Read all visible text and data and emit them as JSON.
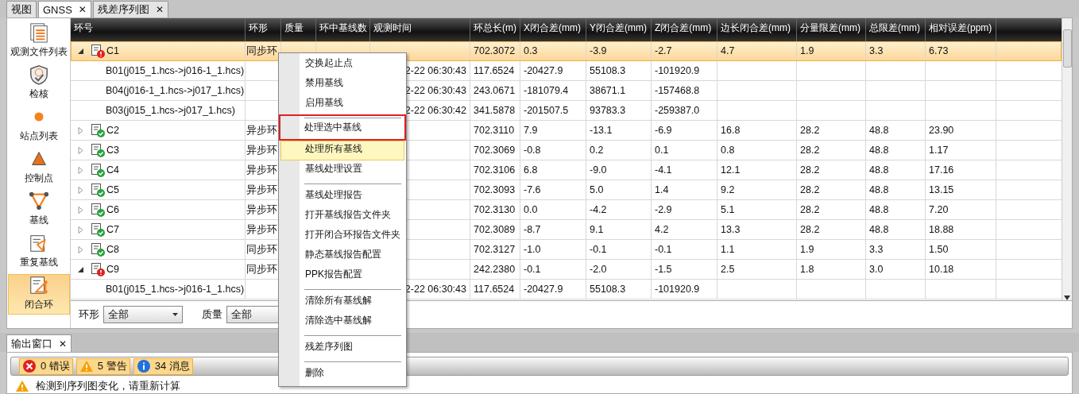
{
  "doc_tabs": [
    {
      "label": "视图",
      "selected": false
    },
    {
      "label": "GNSS",
      "selected": true,
      "close": "✕"
    },
    {
      "label": "残差序列图",
      "selected": false,
      "close": "✕"
    }
  ],
  "sidebar": {
    "items": [
      {
        "label": "观测文件列表",
        "selected": false
      },
      {
        "label": "检核",
        "selected": false
      },
      {
        "label": "站点列表",
        "selected": false
      },
      {
        "label": "控制点",
        "selected": false
      },
      {
        "label": "基线",
        "selected": false
      },
      {
        "label": "重复基线",
        "selected": false
      },
      {
        "label": "闭合环",
        "selected": true
      }
    ]
  },
  "table": {
    "columns": [
      "环号",
      "环形",
      "质量",
      "环中基线数",
      "观测时间",
      "环总长(m)",
      "X闭合差(mm)",
      "Y闭合差(mm)",
      "Z闭合差(mm)",
      "边长闭合差(mm)",
      "分量限差(mm)",
      "总限差(mm)",
      "相对误差(ppm)"
    ],
    "rows": [
      {
        "kind": "ring",
        "expanded": true,
        "error": true,
        "selected": true,
        "cells": [
          "C1",
          "同步环",
          "",
          "",
          "",
          "702.3072",
          "0.3",
          "-3.9",
          "-2.7",
          "4.7",
          "1.9",
          "3.3",
          "6.73"
        ]
      },
      {
        "kind": "baseline",
        "selected": false,
        "cells": [
          "B01(j015_1.hcs->j016-1_1.hcs)",
          "",
          "",
          "",
          "2-22 06:30:43",
          "117.6524",
          "-20427.9",
          "55108.3",
          "-101920.9",
          "",
          "",
          "",
          ""
        ]
      },
      {
        "kind": "baseline",
        "selected": false,
        "cells": [
          "B04(j016-1_1.hcs->j017_1.hcs)",
          "",
          "",
          "",
          "2-22 06:30:43",
          "243.0671",
          "-181079.4",
          "38671.1",
          "-157468.8",
          "",
          "",
          "",
          ""
        ]
      },
      {
        "kind": "baseline",
        "selected": false,
        "cells": [
          "B03(j015_1.hcs->j017_1.hcs)",
          "",
          "",
          "",
          "2-22 06:30:42",
          "341.5878",
          "-201507.5",
          "93783.3",
          "-259387.0",
          "",
          "",
          "",
          ""
        ]
      },
      {
        "kind": "ring",
        "expanded": false,
        "error": false,
        "selected": false,
        "cells": [
          "C2",
          "异步环",
          "",
          "",
          "",
          "702.3110",
          "7.9",
          "-13.1",
          "-6.9",
          "16.8",
          "28.2",
          "48.8",
          "23.90"
        ]
      },
      {
        "kind": "ring",
        "expanded": false,
        "error": false,
        "selected": false,
        "cells": [
          "C3",
          "异步环",
          "",
          "",
          "",
          "702.3069",
          "-0.8",
          "0.2",
          "0.1",
          "0.8",
          "28.2",
          "48.8",
          "1.17"
        ]
      },
      {
        "kind": "ring",
        "expanded": false,
        "error": false,
        "selected": false,
        "cells": [
          "C4",
          "异步环",
          "",
          "",
          "",
          "702.3106",
          "6.8",
          "-9.0",
          "-4.1",
          "12.1",
          "28.2",
          "48.8",
          "17.16"
        ]
      },
      {
        "kind": "ring",
        "expanded": false,
        "error": false,
        "selected": false,
        "cells": [
          "C5",
          "异步环",
          "",
          "",
          "",
          "702.3093",
          "-7.6",
          "5.0",
          "1.4",
          "9.2",
          "28.2",
          "48.8",
          "13.15"
        ]
      },
      {
        "kind": "ring",
        "expanded": false,
        "error": false,
        "selected": false,
        "cells": [
          "C6",
          "异步环",
          "",
          "",
          "",
          "702.3130",
          "0.0",
          "-4.2",
          "-2.9",
          "5.1",
          "28.2",
          "48.8",
          "7.20"
        ]
      },
      {
        "kind": "ring",
        "expanded": false,
        "error": false,
        "selected": false,
        "cells": [
          "C7",
          "异步环",
          "",
          "",
          "",
          "702.3089",
          "-8.7",
          "9.1",
          "4.2",
          "13.3",
          "28.2",
          "48.8",
          "18.88"
        ]
      },
      {
        "kind": "ring",
        "expanded": false,
        "error": false,
        "selected": false,
        "cells": [
          "C8",
          "同步环",
          "",
          "",
          "",
          "702.3127",
          "-1.0",
          "-0.1",
          "-0.1",
          "1.1",
          "1.9",
          "3.3",
          "1.50"
        ]
      },
      {
        "kind": "ring",
        "expanded": true,
        "error": true,
        "selected": false,
        "cells": [
          "C9",
          "同步环",
          "",
          "",
          "",
          "242.2380",
          "-0.1",
          "-2.0",
          "-1.5",
          "2.5",
          "1.8",
          "3.0",
          "10.18"
        ]
      },
      {
        "kind": "baseline",
        "selected": false,
        "cells": [
          "B01(j015_1.hcs->j016-1_1.hcs)",
          "",
          "",
          "",
          "2-22 06:30:43",
          "117.6524",
          "-20427.9",
          "55108.3",
          "-101920.9",
          "",
          "",
          "",
          ""
        ]
      }
    ]
  },
  "filters": [
    {
      "label": "环形",
      "value": "全部"
    },
    {
      "label": "质量",
      "value": "全部"
    }
  ],
  "context_menu": {
    "items": [
      {
        "kind": "item",
        "label": "交换起止点",
        "selected": false
      },
      {
        "kind": "item",
        "label": "禁用基线",
        "selected": false
      },
      {
        "kind": "item",
        "label": "启用基线",
        "selected": false
      },
      {
        "kind": "separator"
      },
      {
        "kind": "item",
        "label": "处理选中基线",
        "selected": false,
        "marked": true
      },
      {
        "kind": "item",
        "label": "处理所有基线",
        "selected": true
      },
      {
        "kind": "item",
        "label": "基线处理设置",
        "selected": false
      },
      {
        "kind": "separator"
      },
      {
        "kind": "item",
        "label": "基线处理报告",
        "selected": false
      },
      {
        "kind": "item",
        "label": "打开基线报告文件夹",
        "selected": false
      },
      {
        "kind": "item",
        "label": "打开闭合环报告文件夹",
        "selected": false
      },
      {
        "kind": "item",
        "label": "静态基线报告配置",
        "selected": false
      },
      {
        "kind": "item",
        "label": "PPK报告配置",
        "selected": false
      },
      {
        "kind": "separator"
      },
      {
        "kind": "item",
        "label": "清除所有基线解",
        "selected": false
      },
      {
        "kind": "item",
        "label": "清除选中基线解",
        "selected": false
      },
      {
        "kind": "separator"
      },
      {
        "kind": "item",
        "label": "残差序列图",
        "selected": false
      },
      {
        "kind": "separator"
      },
      {
        "kind": "item",
        "label": "删除",
        "selected": false
      }
    ]
  },
  "output": {
    "tab": {
      "label": "输出窗口",
      "close": "✕"
    },
    "badges": [
      {
        "kind": "error",
        "label": "0 错误"
      },
      {
        "kind": "warning",
        "label": "5 警告"
      },
      {
        "kind": "info",
        "label": "34 消息"
      }
    ],
    "messages": [
      {
        "kind": "warning",
        "text": "检测到序列图变化，请重新计算"
      }
    ]
  }
}
